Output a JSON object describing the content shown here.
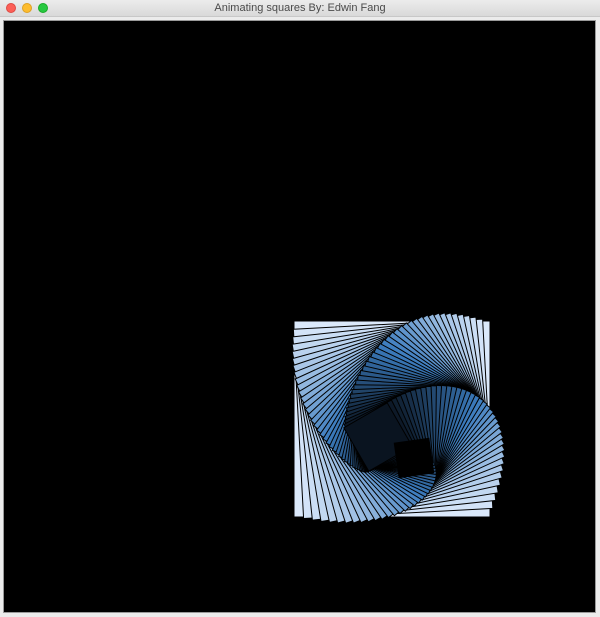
{
  "window": {
    "title": "Animating squares By: Edwin Fang"
  },
  "controls": {
    "close_icon": "close-icon",
    "minimize_icon": "minimize-icon",
    "maximize_icon": "maximize-icon"
  },
  "canvas": {
    "background_color": "#000000",
    "shade_dark": "#0a1420",
    "shade_mid": "#3b7bbd",
    "shade_light": "#dbe9fb",
    "square_count": 40
  }
}
